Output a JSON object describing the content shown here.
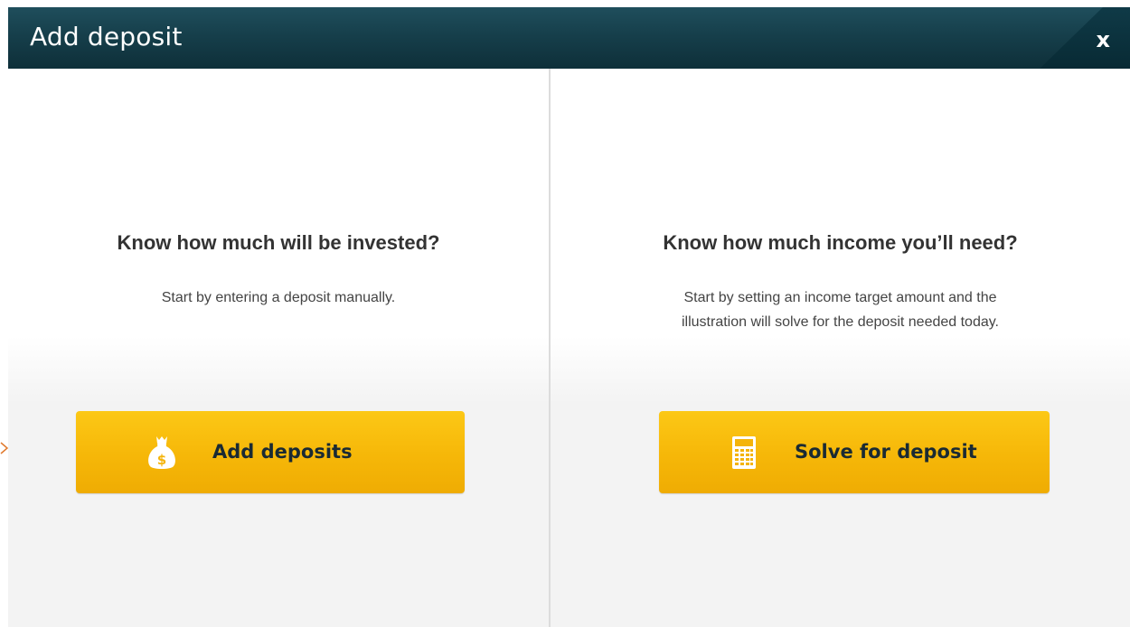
{
  "dialog": {
    "title": "Add deposit",
    "close_label": "x"
  },
  "left_panel": {
    "heading": "Know how much will be invested?",
    "description": "Start by entering a deposit manually.",
    "button_label": "Add deposits",
    "button_icon": "money-bag-icon"
  },
  "right_panel": {
    "heading": "Know how much income you’ll need?",
    "description_line1": "Start by setting an income target amount and the",
    "description_line2": "illustration will solve for the deposit needed today.",
    "button_label": "Solve for deposit",
    "button_icon": "calculator-icon"
  },
  "colors": {
    "titlebar": "#163f4b",
    "button": "#f6b708",
    "button_text": "#1a2a33"
  }
}
